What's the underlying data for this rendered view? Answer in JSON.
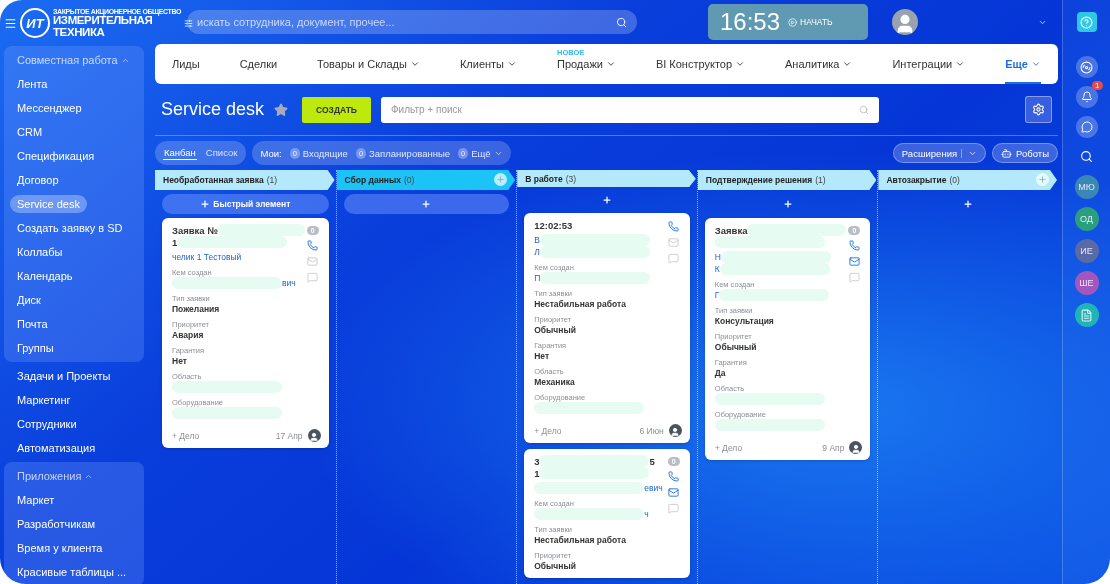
{
  "header": {
    "logo": {
      "mark": "ИТ",
      "caption": "ЗАКРЫТОЕ АКЦИОНЕРНОЕ ОБЩЕСТВО",
      "name_lines": [
        "ИЗМЕРИТЕЛЬНАЯ",
        "ТЕХНИКА"
      ]
    },
    "search": {
      "placeholder": "искать сотрудника, документ, прочее..."
    },
    "clock": {
      "time": "16:53",
      "action": "НАЧАТЬ"
    }
  },
  "sidebar": {
    "sections": [
      {
        "title": "Совместная работа",
        "expanded": true,
        "items": [
          {
            "label": "Лента",
            "selected": false
          },
          {
            "label": "Мессенджер",
            "selected": false
          },
          {
            "label": "CRM",
            "selected": false
          },
          {
            "label": "Спецификация",
            "selected": false
          },
          {
            "label": "Договор",
            "selected": false
          },
          {
            "label": "Service desk",
            "selected": true
          },
          {
            "label": "Создать заявку в SD",
            "selected": false
          },
          {
            "label": "Коллабы",
            "selected": false
          },
          {
            "label": "Календарь",
            "selected": false
          },
          {
            "label": "Диск",
            "selected": false
          },
          {
            "label": "Почта",
            "selected": false
          },
          {
            "label": "Группы",
            "selected": false
          }
        ]
      },
      {
        "items": [
          {
            "label": "Задачи и Проекты",
            "selected": false
          },
          {
            "label": "Маркетинг",
            "selected": false
          },
          {
            "label": "Сотрудники",
            "selected": false
          },
          {
            "label": "Автоматизация",
            "selected": false
          }
        ]
      },
      {
        "title": "Приложения",
        "expanded": true,
        "items": [
          {
            "label": "Маркет",
            "selected": false
          },
          {
            "label": "Разработчикам",
            "selected": false
          },
          {
            "label": "Время у клиента",
            "selected": false
          },
          {
            "label": "Красивые таблицы ...",
            "selected": false
          }
        ]
      }
    ]
  },
  "nav": {
    "items": [
      {
        "label": "Лиды",
        "dropdown": false,
        "selected": false
      },
      {
        "label": "Сделки",
        "dropdown": false,
        "selected": false
      },
      {
        "label": "Товары и Склады",
        "dropdown": true,
        "selected": false
      },
      {
        "label": "Клиенты",
        "dropdown": true,
        "selected": false
      },
      {
        "label": "Продажи",
        "dropdown": true,
        "selected": false,
        "badge": "НОВОЕ"
      },
      {
        "label": "BI Конструктор",
        "dropdown": true,
        "selected": false
      },
      {
        "label": "Аналитика",
        "dropdown": true,
        "selected": false
      },
      {
        "label": "Интеграции",
        "dropdown": true,
        "selected": false
      },
      {
        "label": "Еще",
        "dropdown": true,
        "selected": true
      }
    ]
  },
  "page": {
    "title": "Service desk",
    "favorite": false,
    "create_button": "СОЗДАТЬ",
    "filter": {
      "placeholder": "Фильтр + поиск"
    }
  },
  "toolbar": {
    "views": [
      {
        "label": "Канбан",
        "selected": true
      },
      {
        "label": "Список",
        "selected": false
      }
    ],
    "my_label": "Мои:",
    "counters": [
      {
        "count": "0",
        "label": "Входящие",
        "dropdown": false
      },
      {
        "count": "0",
        "label": "Запланированные",
        "dropdown": false
      },
      {
        "count": "0",
        "label": "Ещё",
        "dropdown": true
      }
    ],
    "extensions": "Расширения",
    "robots": "Роботы"
  },
  "board": {
    "columns": [
      {
        "name": "Необработанная заявка",
        "count": "(1)",
        "color": "#b3e9fb",
        "add_stage": false,
        "add": {
          "kind": "pill",
          "label": "Быстрый элемент"
        },
        "cards": [
          {
            "title": [
              {
                "before": "Заявка №",
                "hidden": true
              },
              {
                "before": "1",
                "hidden": true
              }
            ],
            "contact": [
              {
                "before": "челик 1 Тестовый",
                "hidden": false
              }
            ],
            "creator_label": "Кем создан",
            "creator": [
              {
                "hidden": true,
                "after": "вич"
              }
            ],
            "fields": [
              {
                "label": "Тип заявки",
                "value": {
                  "before": "Пожелания",
                  "hidden": false
                }
              },
              {
                "label": "Приоритет",
                "value": {
                  "before": "Авария",
                  "hidden": false
                }
              },
              {
                "label": "Гарантия",
                "value": {
                  "before": "Нет",
                  "hidden": false
                }
              },
              {
                "label": "Область",
                "value": {
                  "hidden": true
                }
              },
              {
                "label": "Оборудование",
                "value": {
                  "hidden": true
                }
              }
            ],
            "activity": "+ Дело",
            "date": "17 Апр",
            "counter": "0",
            "mail_active": false
          }
        ]
      },
      {
        "name": "Сбор данных",
        "count": "(0)",
        "color": "#1cc3f6",
        "add_stage": true,
        "add": {
          "kind": "pill"
        }
      },
      {
        "name": "В работе",
        "count": "(3)",
        "color": "#b3e9fb",
        "add_stage": false,
        "add": {
          "kind": "plain"
        },
        "cards": [
          {
            "title": [
              {
                "before": "12:02:53",
                "hidden": false
              }
            ],
            "contact": [
              {
                "before": "В",
                "hidden": true
              },
              {
                "before": "Л",
                "hidden": true
              }
            ],
            "creator_label": "Кем создан",
            "creator": [
              {
                "before": "П",
                "hidden": true
              }
            ],
            "fields": [
              {
                "label": "Тип заявки",
                "value": {
                  "before": "Нестабильная работа",
                  "hidden": false
                }
              },
              {
                "label": "Приоритет",
                "value": {
                  "before": "Обычный",
                  "hidden": false
                }
              },
              {
                "label": "Гарантия",
                "value": {
                  "before": "Нет",
                  "hidden": false
                }
              },
              {
                "label": "Область",
                "value": {
                  "before": "Механика",
                  "hidden": false
                }
              },
              {
                "label": "Оборудование",
                "value": {
                  "hidden": true
                }
              }
            ],
            "activity": "+ Дело",
            "date": "6 Июн",
            "mail_active": false
          },
          {
            "title": [
              {
                "before": "3",
                "hidden": true,
                "after": "5"
              },
              {
                "before": "1",
                "hidden": true
              }
            ],
            "contact": [
              {
                "hidden": true,
                "after": "евич"
              }
            ],
            "creator_label": "Кем создан",
            "creator": [
              {
                "hidden": true,
                "after": "ч"
              }
            ],
            "fields": [
              {
                "label": "Тип заявки",
                "value": {
                  "before": "Нестабильная работа",
                  "hidden": false
                }
              },
              {
                "label": "Приоритет",
                "value": {
                  "before": "Обычный",
                  "hidden": false
                }
              }
            ],
            "counter": "0",
            "mail_active": true
          }
        ]
      },
      {
        "name": "Подтверждение решения",
        "count": "(1)",
        "color": "#b3e9fb",
        "add_stage": false,
        "add": {
          "kind": "plain"
        },
        "cards": [
          {
            "title": [
              {
                "before": "Заявка",
                "hidden": true
              },
              {
                "hidden": true
              }
            ],
            "contact": [
              {
                "before": "Н",
                "hidden": true
              },
              {
                "before": "К",
                "hidden": true
              }
            ],
            "creator_label": "Кем создан",
            "creator": [
              {
                "before": "Г",
                "hidden": true
              }
            ],
            "fields": [
              {
                "label": "Тип заявки",
                "value": {
                  "before": "Консультация",
                  "hidden": false
                }
              },
              {
                "label": "Приоритет",
                "value": {
                  "before": "Обычный",
                  "hidden": false
                }
              },
              {
                "label": "Гарантия",
                "value": {
                  "before": "Да",
                  "hidden": false
                }
              },
              {
                "label": "Область",
                "value": {
                  "hidden": true
                }
              },
              {
                "label": "Оборудование",
                "value": {
                  "hidden": true
                }
              }
            ],
            "activity": "+ Дело",
            "date": "9 Апр",
            "counter": "0",
            "mail_active": true
          }
        ]
      },
      {
        "name": "Автозакрытие",
        "count": "(0)",
        "color": "#b3e9fb",
        "add_stage": true,
        "add": {
          "kind": "plain"
        }
      }
    ]
  },
  "right_rail": {
    "notifications": "1",
    "avatars": [
      {
        "initials": "МЮ",
        "color": "#3b86b4"
      },
      {
        "initials": "ОД",
        "color": "#2a9e7e"
      },
      {
        "initials": "ИЕ",
        "color": "#5a6aa6"
      },
      {
        "initials": "ШЕ",
        "color": "#a257c0"
      }
    ]
  }
}
